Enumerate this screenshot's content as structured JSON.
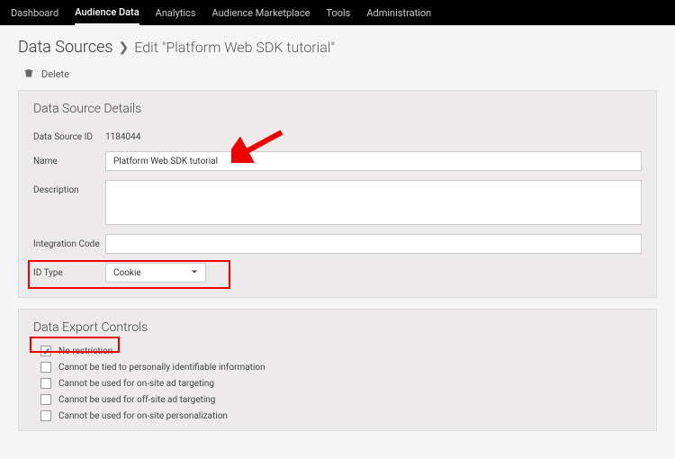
{
  "nav": {
    "items": [
      {
        "label": "Dashboard"
      },
      {
        "label": "Audience Data"
      },
      {
        "label": "Analytics"
      },
      {
        "label": "Audience Marketplace"
      },
      {
        "label": "Tools"
      },
      {
        "label": "Administration"
      }
    ],
    "activeIndex": 1
  },
  "breadcrumb": {
    "root": "Data Sources",
    "sep": "❯",
    "current": "Edit \"Platform Web SDK tutorial\""
  },
  "delete_action": "Delete",
  "details": {
    "title": "Data Source Details",
    "dataSourceIdLabel": "Data Source ID",
    "dataSourceId": "1184044",
    "nameLabel": "Name",
    "nameValue": "Platform Web SDK tutorial",
    "descriptionLabel": "Description",
    "descriptionValue": "",
    "integrationCodeLabel": "Integration Code",
    "integrationCodeValue": "",
    "idTypeLabel": "ID Type",
    "idTypeValue": "Cookie"
  },
  "export": {
    "title": "Data Export Controls",
    "items": [
      {
        "label": "No restriction",
        "checked": true
      },
      {
        "label": "Cannot be tied to personally identifiable information",
        "checked": false
      },
      {
        "label": "Cannot be used for on-site ad targeting",
        "checked": false
      },
      {
        "label": "Cannot be used for off-site ad targeting",
        "checked": false
      },
      {
        "label": "Cannot be used for on-site personalization",
        "checked": false
      }
    ]
  }
}
